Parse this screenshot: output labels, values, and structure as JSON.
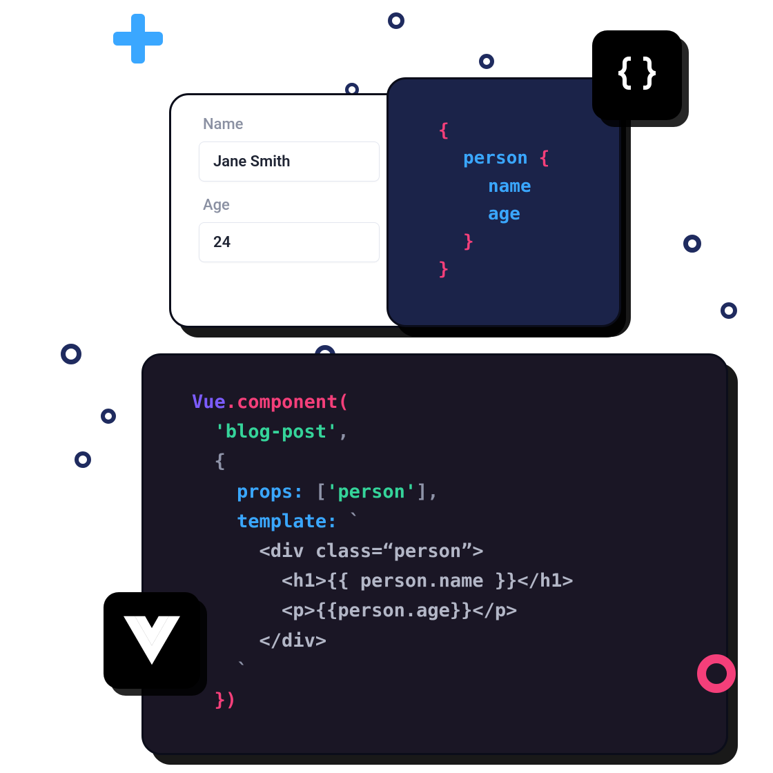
{
  "form": {
    "name_label": "Name",
    "name_value": "Jane Smith",
    "age_label": "Age",
    "age_value": "24"
  },
  "schema": {
    "open_brace": "{",
    "entity": "person",
    "entity_open": " {",
    "field_name": "name",
    "field_age": "age",
    "close_inner": "}",
    "close_outer": "}"
  },
  "vue": {
    "l1_vue": "Vue",
    "l1_dot": ".",
    "l1_component": "component(",
    "l2_name": "'blog-post'",
    "l2_comma": ",",
    "l3_brace": "{",
    "l4_props": "props: ",
    "l4_bracket_open": "[",
    "l4_value": "'person'",
    "l4_bracket_close": "],",
    "l5_template": "template: ",
    "l5_tick": "`",
    "l6": "<div class=“person”>",
    "l7": "<h1>{{ person.name }}</h1>",
    "l8": "<p>{{person.age}}</p>",
    "l9": "</div>",
    "l10_tick": "`",
    "l11_close": "})"
  },
  "icons": {
    "code_braces": "code-braces-icon",
    "vue_logo": "vue-logo-icon",
    "plus": "plus-icon"
  },
  "colors": {
    "pink": "#f43f7a",
    "blue": "#3aa7ff",
    "purple": "#7c5cff",
    "green": "#35d49a",
    "schema_bg": "#1b2349",
    "code_bg": "#1a1625",
    "ring_navy": "#1f2b5f"
  }
}
